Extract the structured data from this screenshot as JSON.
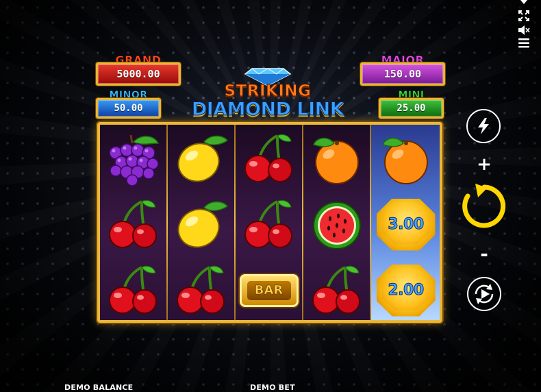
{
  "jackpots": {
    "grand": {
      "label": "GRAND",
      "value": "5000.00"
    },
    "major": {
      "label": "MAJOR",
      "value": "150.00"
    },
    "minor": {
      "label": "MINOR",
      "value": "50.00"
    },
    "mini": {
      "label": "MINI",
      "value": "25.00"
    }
  },
  "logo": {
    "line1": "STRIKING",
    "line2": "DIAMOND LINK"
  },
  "reels": [
    [
      "grapes",
      "cherry",
      "cherry"
    ],
    [
      "lemon",
      "lemon",
      "cherry"
    ],
    [
      "cherry",
      "cherry",
      "bar"
    ],
    [
      "orange",
      "watermelon",
      "cherry"
    ],
    [
      "orange",
      "coin",
      "coin"
    ]
  ],
  "coins": {
    "reel5_row2": "3.00",
    "reel5_row3": "2.00"
  },
  "bar_label": "BAR",
  "controls": {
    "plus": "+",
    "minus": "-",
    "icons": [
      "turbo-icon",
      "spin-icon",
      "autoplay-icon",
      "fullscreen-icon",
      "mute-icon",
      "menu-icon"
    ]
  },
  "footer": {
    "balance_label": "DEMO BALANCE",
    "bet_label": "DEMO BET"
  },
  "colors": {
    "frame_gold": "#e9b83a",
    "grand": "#e63a2c",
    "major": "#d454e0",
    "minor": "#3a9af0",
    "mini": "#3fc23a"
  }
}
